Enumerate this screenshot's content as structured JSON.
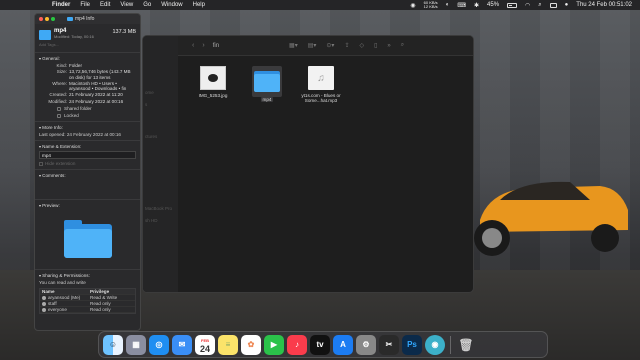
{
  "menubar": {
    "app": "Finder",
    "menus": [
      "File",
      "Edit",
      "View",
      "Go",
      "Window",
      "Help"
    ],
    "net_up": "60 KB/s",
    "net_down": "12 KB/s",
    "battery_pct": "45%",
    "datetime": "Thu 24 Feb  00:51:02"
  },
  "info_window": {
    "title": "mp4 Info",
    "name": "mp4",
    "size": "137.3 MB",
    "modified": "Modified: Today, 00:16",
    "tags_placeholder": "Add Tags...",
    "general": {
      "heading": "General:",
      "kind_label": "Kind:",
      "kind": "Folder",
      "size_label": "Size:",
      "size": "13,72,56,746 bytes (143.7 MB on disk) for 13 items",
      "where_label": "Where:",
      "where": "Macintosh HD • Users • aryansood • Downloads • fin",
      "created_label": "Created:",
      "created": "21 February 2022 at 11:20",
      "modified_label": "Modified:",
      "modified": "24 February 2022 at 00:16",
      "shared": "Shared folder",
      "locked": "Locked"
    },
    "more_info": {
      "heading": "More Info:",
      "last_opened": "Last opened: 24 February 2022 at 00:16"
    },
    "name_ext": {
      "heading": "Name & Extension:",
      "value": "mp4",
      "hide": "Hide extension"
    },
    "comments": {
      "heading": "Comments:"
    },
    "preview": {
      "heading": "Preview:"
    },
    "sharing": {
      "heading": "Sharing & Permissions:",
      "summary": "You can read and write",
      "col_name": "Name",
      "col_priv": "Privilege",
      "rows": [
        {
          "name": "aryansood (Me)",
          "priv": "Read & Write"
        },
        {
          "name": "staff",
          "priv": "Read only"
        },
        {
          "name": "everyone",
          "priv": "Read only"
        }
      ]
    }
  },
  "finder": {
    "title": "fin",
    "sidebar_ghosts": [
      "ome",
      "s",
      "ctures",
      "MacBook Pro",
      "sh HD"
    ],
    "files": [
      {
        "label": "IMG_5253.jpg"
      },
      {
        "label": "mp4"
      },
      {
        "label": "yt1s.com - Blues or Some...hat.mp3"
      }
    ]
  },
  "dock": {
    "calendar_month": "FEB",
    "calendar_day": "24",
    "apps": [
      "finder",
      "launchpad",
      "safari",
      "mail",
      "calendar",
      "notes",
      "photos",
      "facetime",
      "music",
      "tv",
      "appstore",
      "settings",
      "finalcut",
      "photoshop",
      "network",
      "trash"
    ]
  }
}
